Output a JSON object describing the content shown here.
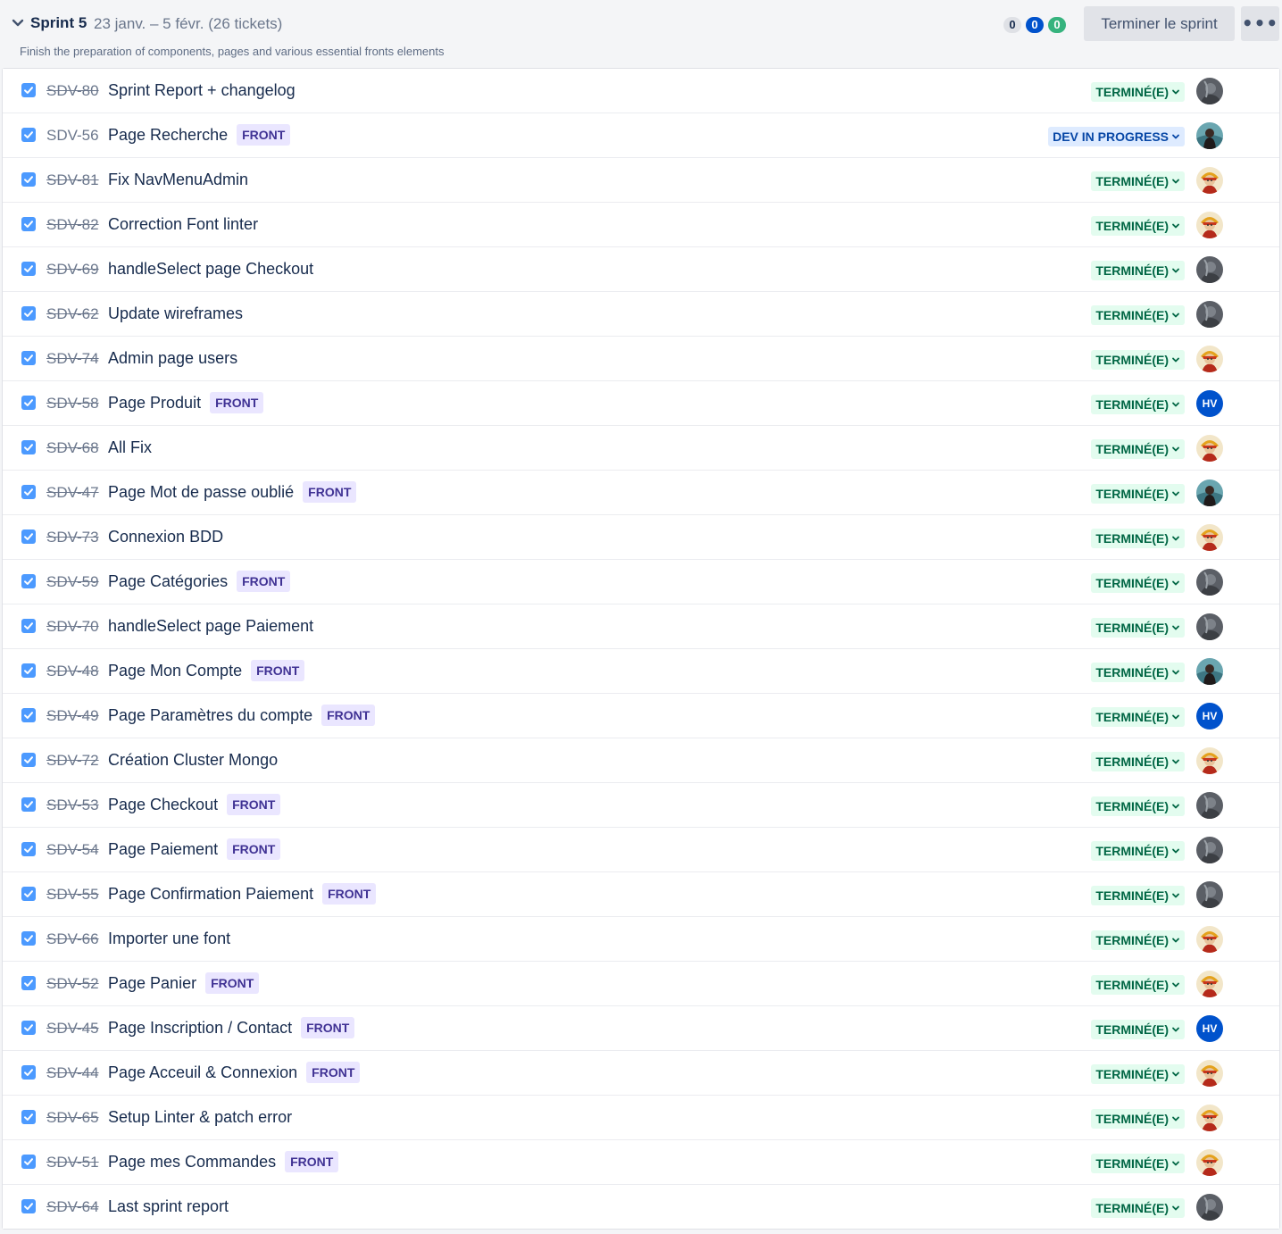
{
  "sprint": {
    "name": "Sprint 5",
    "dates": "23 janv. – 5 févr.  (26 tickets)",
    "goal": "Finish the preparation of components, pages and various essential fronts elements",
    "counts": {
      "todo": "0",
      "in_progress": "0",
      "done": "0"
    },
    "complete_label": "Terminer le sprint",
    "more_label": "•••"
  },
  "colors": {
    "todo": "#dfe1e6",
    "in_progress": "#0052cc",
    "done": "#36b37e",
    "checkbox": "#4c9aff",
    "epic_bg": "#eae6ff",
    "epic_text": "#403294"
  },
  "issues": [
    {
      "key": "SDV-80",
      "summary": "Sprint Report + changelog",
      "epic": "",
      "status": "TERMINÉ(E)",
      "done": true,
      "assignee": "gray"
    },
    {
      "key": "SDV-56",
      "summary": "Page Recherche",
      "epic": "FRONT",
      "status": "DEV IN PROGRESS",
      "done": false,
      "assignee": "teal"
    },
    {
      "key": "SDV-81",
      "summary": "Fix NavMenuAdmin",
      "epic": "",
      "status": "TERMINÉ(E)",
      "done": true,
      "assignee": "gold"
    },
    {
      "key": "SDV-82",
      "summary": "Correction Font linter",
      "epic": "",
      "status": "TERMINÉ(E)",
      "done": true,
      "assignee": "gold"
    },
    {
      "key": "SDV-69",
      "summary": "handleSelect page Checkout",
      "epic": "",
      "status": "TERMINÉ(E)",
      "done": true,
      "assignee": "gray"
    },
    {
      "key": "SDV-62",
      "summary": "Update wireframes",
      "epic": "",
      "status": "TERMINÉ(E)",
      "done": true,
      "assignee": "gray"
    },
    {
      "key": "SDV-74",
      "summary": "Admin page users",
      "epic": "",
      "status": "TERMINÉ(E)",
      "done": true,
      "assignee": "gold"
    },
    {
      "key": "SDV-58",
      "summary": "Page Produit",
      "epic": "FRONT",
      "status": "TERMINÉ(E)",
      "done": true,
      "assignee": "HV"
    },
    {
      "key": "SDV-68",
      "summary": "All Fix",
      "epic": "",
      "status": "TERMINÉ(E)",
      "done": true,
      "assignee": "gold"
    },
    {
      "key": "SDV-47",
      "summary": "Page Mot de passe oublié",
      "epic": "FRONT",
      "status": "TERMINÉ(E)",
      "done": true,
      "assignee": "teal"
    },
    {
      "key": "SDV-73",
      "summary": "Connexion BDD",
      "epic": "",
      "status": "TERMINÉ(E)",
      "done": true,
      "assignee": "gold"
    },
    {
      "key": "SDV-59",
      "summary": "Page Catégories",
      "epic": "FRONT",
      "status": "TERMINÉ(E)",
      "done": true,
      "assignee": "gray"
    },
    {
      "key": "SDV-70",
      "summary": "handleSelect page Paiement",
      "epic": "",
      "status": "TERMINÉ(E)",
      "done": true,
      "assignee": "gray"
    },
    {
      "key": "SDV-48",
      "summary": "Page Mon Compte",
      "epic": "FRONT",
      "status": "TERMINÉ(E)",
      "done": true,
      "assignee": "teal"
    },
    {
      "key": "SDV-49",
      "summary": "Page Paramètres du compte",
      "epic": "FRONT",
      "status": "TERMINÉ(E)",
      "done": true,
      "assignee": "HV"
    },
    {
      "key": "SDV-72",
      "summary": "Création Cluster Mongo",
      "epic": "",
      "status": "TERMINÉ(E)",
      "done": true,
      "assignee": "gold"
    },
    {
      "key": "SDV-53",
      "summary": "Page Checkout",
      "epic": "FRONT",
      "status": "TERMINÉ(E)",
      "done": true,
      "assignee": "gray"
    },
    {
      "key": "SDV-54",
      "summary": "Page Paiement",
      "epic": "FRONT",
      "status": "TERMINÉ(E)",
      "done": true,
      "assignee": "gray"
    },
    {
      "key": "SDV-55",
      "summary": "Page Confirmation Paiement",
      "epic": "FRONT",
      "status": "TERMINÉ(E)",
      "done": true,
      "assignee": "gray"
    },
    {
      "key": "SDV-66",
      "summary": "Importer une font",
      "epic": "",
      "status": "TERMINÉ(E)",
      "done": true,
      "assignee": "gold"
    },
    {
      "key": "SDV-52",
      "summary": "Page Panier",
      "epic": "FRONT",
      "status": "TERMINÉ(E)",
      "done": true,
      "assignee": "gold"
    },
    {
      "key": "SDV-45",
      "summary": "Page Inscription / Contact",
      "epic": "FRONT",
      "status": "TERMINÉ(E)",
      "done": true,
      "assignee": "HV"
    },
    {
      "key": "SDV-44",
      "summary": "Page Acceuil & Connexion",
      "epic": "FRONT",
      "status": "TERMINÉ(E)",
      "done": true,
      "assignee": "gold"
    },
    {
      "key": "SDV-65",
      "summary": "Setup Linter & patch error",
      "epic": "",
      "status": "TERMINÉ(E)",
      "done": true,
      "assignee": "gold"
    },
    {
      "key": "SDV-51",
      "summary": "Page mes Commandes",
      "epic": "FRONT",
      "status": "TERMINÉ(E)",
      "done": true,
      "assignee": "gold"
    },
    {
      "key": "SDV-64",
      "summary": "Last sprint report",
      "epic": "",
      "status": "TERMINÉ(E)",
      "done": true,
      "assignee": "gray"
    }
  ]
}
